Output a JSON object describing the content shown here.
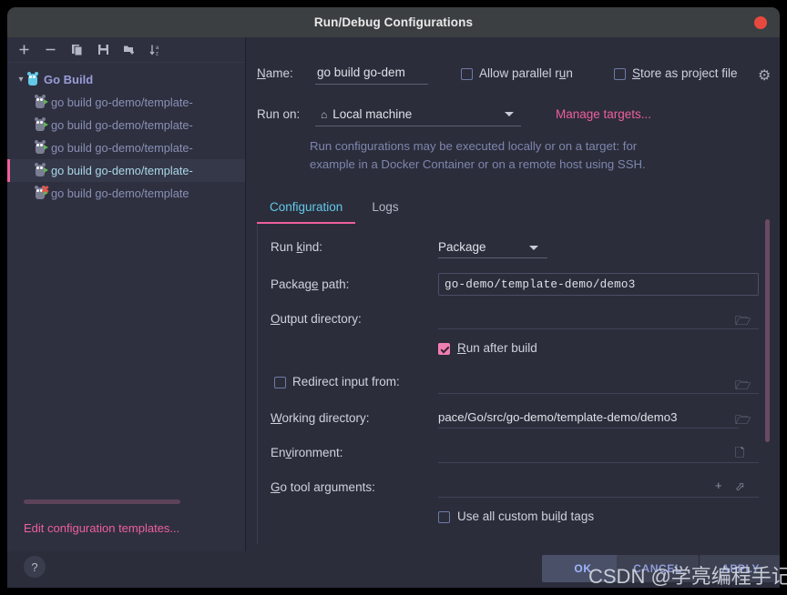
{
  "window": {
    "title": "Run/Debug Configurations",
    "close_icon": "close-dot"
  },
  "toolbar": {
    "items": [
      {
        "name": "add-icon",
        "glyph": "+"
      },
      {
        "name": "remove-icon",
        "glyph": "−"
      },
      {
        "name": "copy-icon",
        "glyph": "copy"
      },
      {
        "name": "save-icon",
        "glyph": "save"
      },
      {
        "name": "new-folder-icon",
        "glyph": "folder-plus"
      },
      {
        "name": "sort-alphabetically-icon",
        "glyph": "sort-az"
      }
    ]
  },
  "sidebar": {
    "group": {
      "label": "Go Build",
      "expanded": true
    },
    "items": [
      {
        "label": "go build go-demo/template-",
        "selected": false,
        "error": false
      },
      {
        "label": "go build go-demo/template-",
        "selected": false,
        "error": false
      },
      {
        "label": "go build go-demo/template-",
        "selected": false,
        "error": false
      },
      {
        "label": "go build go-demo/template-",
        "selected": true,
        "error": false
      },
      {
        "label": "go build go-demo/template",
        "selected": false,
        "error": true
      }
    ],
    "edit_templates_link": "Edit configuration templates..."
  },
  "form": {
    "name_label": "Name:",
    "name_value": "go build go-dem",
    "allow_parallel_run_label": "Allow parallel run",
    "allow_parallel_run_checked": false,
    "store_as_project_file_label": "Store as project file",
    "store_as_project_file_checked": false,
    "gear_icon": "gear-icon",
    "run_on_label": "Run on:",
    "run_on_value": "Local machine",
    "manage_targets_link": "Manage targets...",
    "hint_line1": "Run configurations may be executed locally or on a target: for",
    "hint_line2": "example in a Docker Container or on a remote host using SSH."
  },
  "tabs": [
    {
      "label": "Configuration",
      "active": true
    },
    {
      "label": "Logs",
      "active": false
    }
  ],
  "config": {
    "run_kind_label": "Run kind:",
    "run_kind_value": "Package",
    "package_path_label": "Package path:",
    "package_path_value": "go-demo/template-demo/demo3",
    "output_directory_label": "Output directory:",
    "output_directory_value": "",
    "run_after_build_label": "Run after build",
    "run_after_build_checked": true,
    "redirect_input_label": "Redirect input from:",
    "redirect_input_checked": false,
    "redirect_input_value": "",
    "working_directory_label": "Working directory:",
    "working_directory_value": "pace/Go/src/go-demo/template-demo/demo3",
    "environment_label": "Environment:",
    "environment_value": "",
    "go_tool_arguments_label": "Go tool arguments:",
    "go_tool_arguments_value": "",
    "use_all_custom_build_tags_label": "Use all custom build tags",
    "use_all_custom_build_tags_checked": false
  },
  "footer": {
    "help_label": "?",
    "ok_label": "OK",
    "cancel_label": "CANCEL",
    "apply_label": "APPLY"
  },
  "watermark": "CSDN @学亮编程手记",
  "colors": {
    "accent_pink": "#ef5f9c",
    "accent_cyan": "#63c9e8",
    "window_bg": "#2b2d3b",
    "titlebar_bg": "#3c3f41",
    "close_red": "#e8493e"
  }
}
